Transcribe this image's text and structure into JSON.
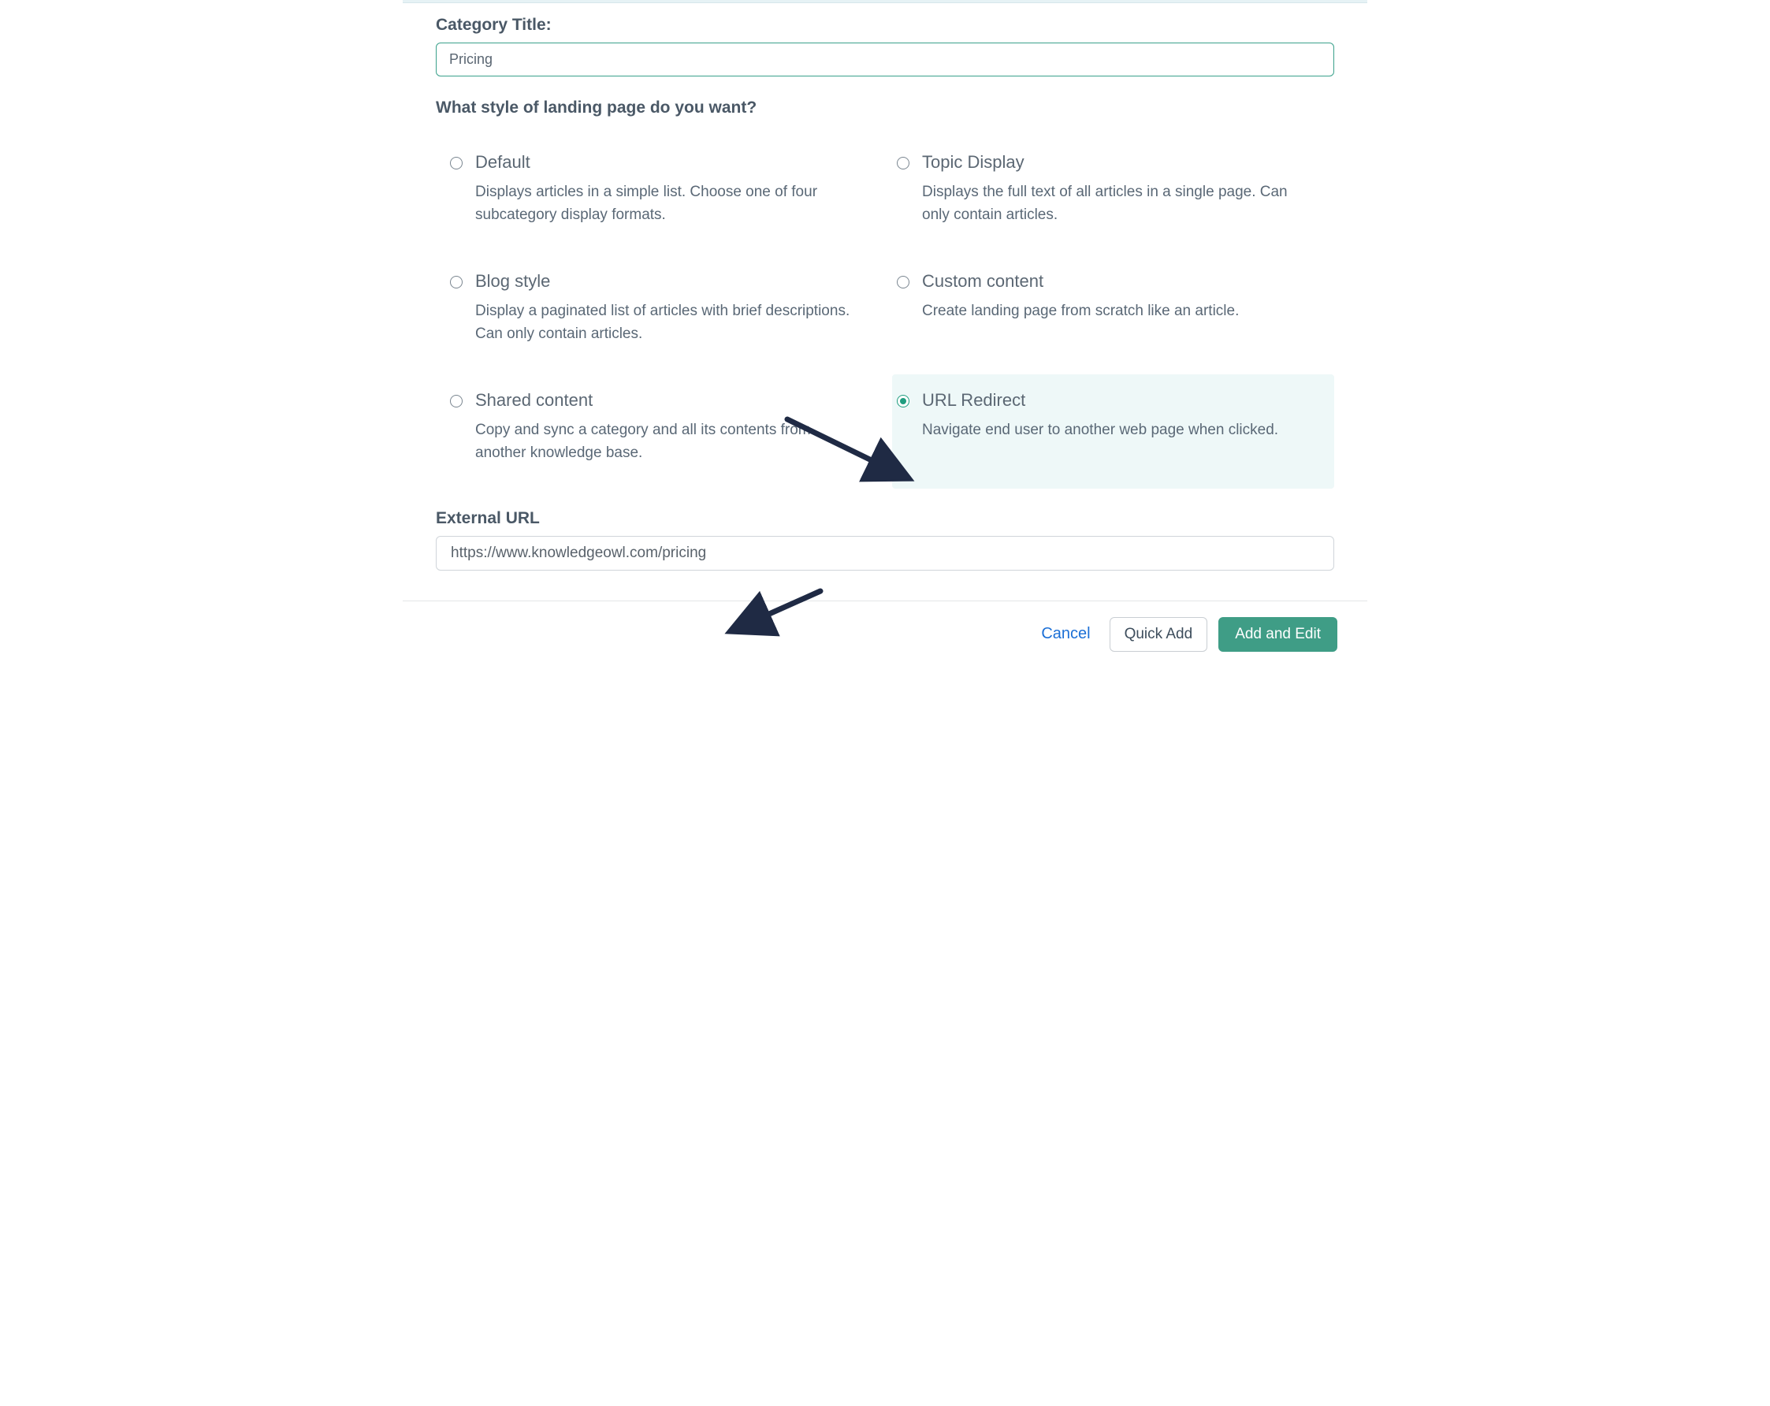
{
  "labels": {
    "category_title": "Category Title:",
    "question": "What style of landing page do you want?",
    "external_url": "External URL"
  },
  "inputs": {
    "category_title_value": "Pricing",
    "external_url_value": "https://www.knowledgeowl.com/pricing"
  },
  "options": [
    {
      "title": "Default",
      "desc": "Displays articles in a simple list. Choose one of four subcategory display formats."
    },
    {
      "title": "Topic Display",
      "desc": "Displays the full text of all articles in a single page. Can only contain articles."
    },
    {
      "title": "Blog style",
      "desc": "Display a paginated list of articles with brief descriptions. Can only contain articles."
    },
    {
      "title": "Custom content",
      "desc": "Create landing page from scratch like an article."
    },
    {
      "title": "Shared content",
      "desc": "Copy and sync a category and all its contents from another knowledge base."
    },
    {
      "title": "URL Redirect",
      "desc": "Navigate end user to another web page when clicked."
    }
  ],
  "selected_index": 5,
  "buttons": {
    "cancel": "Cancel",
    "quick_add": "Quick Add",
    "add_and_edit": "Add and Edit"
  }
}
